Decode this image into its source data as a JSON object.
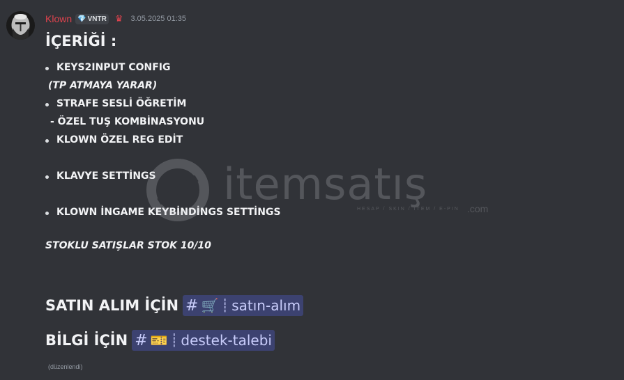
{
  "author": {
    "username": "Klown",
    "tag": "VNTR",
    "tag_icon": "diamond-icon",
    "role_icon": "crown-icon",
    "timestamp": "3.05.2025 01:35"
  },
  "content": {
    "heading": "İÇERİĞİ :",
    "items": [
      {
        "text": "KEYS2INPUT CONFIG",
        "bullet": true
      },
      {
        "text": "(TP ATMAYA YARAR)",
        "italic": true
      },
      {
        "text": "STRAFE SESLİ ÖĞRETİM",
        "bullet": true
      },
      {
        "text": "- ÖZEL TUŞ KOMBİNASYONU"
      },
      {
        "text": "KLOWN ÖZEL REG EDİT",
        "bullet": true
      },
      {
        "text": "KLAVYE SETTİNGS",
        "bullet": true
      },
      {
        "text": "KLOWN İNGAME KEYBİNDİNGS SETTİNGS",
        "bullet": true
      }
    ],
    "stock": "STOKLU SATIŞLAR STOK 10/10",
    "purchase": {
      "label": "SATIN ALIM İÇİN",
      "channel_emoji": "🛒",
      "channel_name": "satın-alım"
    },
    "info": {
      "label": "BİLGİ İÇİN",
      "channel_emoji": "🎫",
      "channel_name": "destek-talebi"
    },
    "edited": "(düzenlendi)"
  },
  "watermark": {
    "brand": "itemsatış",
    "tagline": "HESAP / SKIN / ITEM / E-PIN",
    "suffix": ".com"
  },
  "colors": {
    "background": "#313338",
    "username": "#e0434e",
    "mention_bg": "#3c4270",
    "mention_fg": "#c9cdfb"
  }
}
